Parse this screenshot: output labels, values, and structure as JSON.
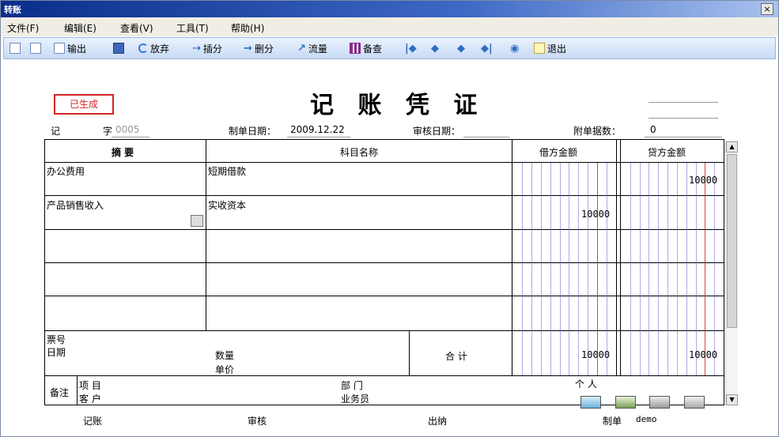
{
  "window": {
    "title": "转账",
    "close_glyph": "×"
  },
  "menu": [
    "文件(F)",
    "编辑(E)",
    "查看(V)",
    "工具(T)",
    "帮助(H)"
  ],
  "toolbar": {
    "output": "输出",
    "abandon": "放弃",
    "insert_split": "插分",
    "delete_split": "删分",
    "flow": "流量",
    "backup": "备查",
    "exit": "退出"
  },
  "voucher": {
    "stamp": "已生成",
    "title": "记 账 凭 证",
    "type_label": "记",
    "no_label": "字",
    "no_value": "0005",
    "make_date_label": "制单日期：",
    "make_date": "2009.12.22",
    "audit_date_label": "审核日期：",
    "attach_label": "附单据数：",
    "attach_count": "0"
  },
  "table": {
    "headers": {
      "summary": "摘 要",
      "account": "科目名称",
      "debit": "借方金额",
      "credit": "贷方金额"
    },
    "rows": [
      {
        "summary": "办公费用",
        "account": "短期借款",
        "debit": "",
        "credit": "10000"
      },
      {
        "summary": "产品销售收入",
        "account": "实收资本",
        "debit": "10000",
        "credit": ""
      },
      {
        "summary": "",
        "account": "",
        "debit": "",
        "credit": ""
      },
      {
        "summary": "",
        "account": "",
        "debit": "",
        "credit": ""
      },
      {
        "summary": "",
        "account": "",
        "debit": "",
        "credit": ""
      }
    ],
    "bill_no_label": "票号",
    "date_label": "日期",
    "qty_label": "数量",
    "price_label": "单价",
    "total_label": "合 计",
    "total_debit": "10000",
    "total_credit": "10000",
    "remark_label": "备注",
    "project_label": "项  目",
    "customer_label": "客  户",
    "dept_label": "部  门",
    "salesman_label": "业务员",
    "person_label": "个  人"
  },
  "footer": {
    "bookkeep_label": "记账",
    "audit_label": "审核",
    "cashier_label": "出纳",
    "maker_label": "制单",
    "maker_value": "demo"
  },
  "colors": {
    "titlebar": "#0a2d8a",
    "stamp": "#d62424",
    "debit_line_blue": "#6a6ad8",
    "debit_line_red": "#d23030"
  }
}
